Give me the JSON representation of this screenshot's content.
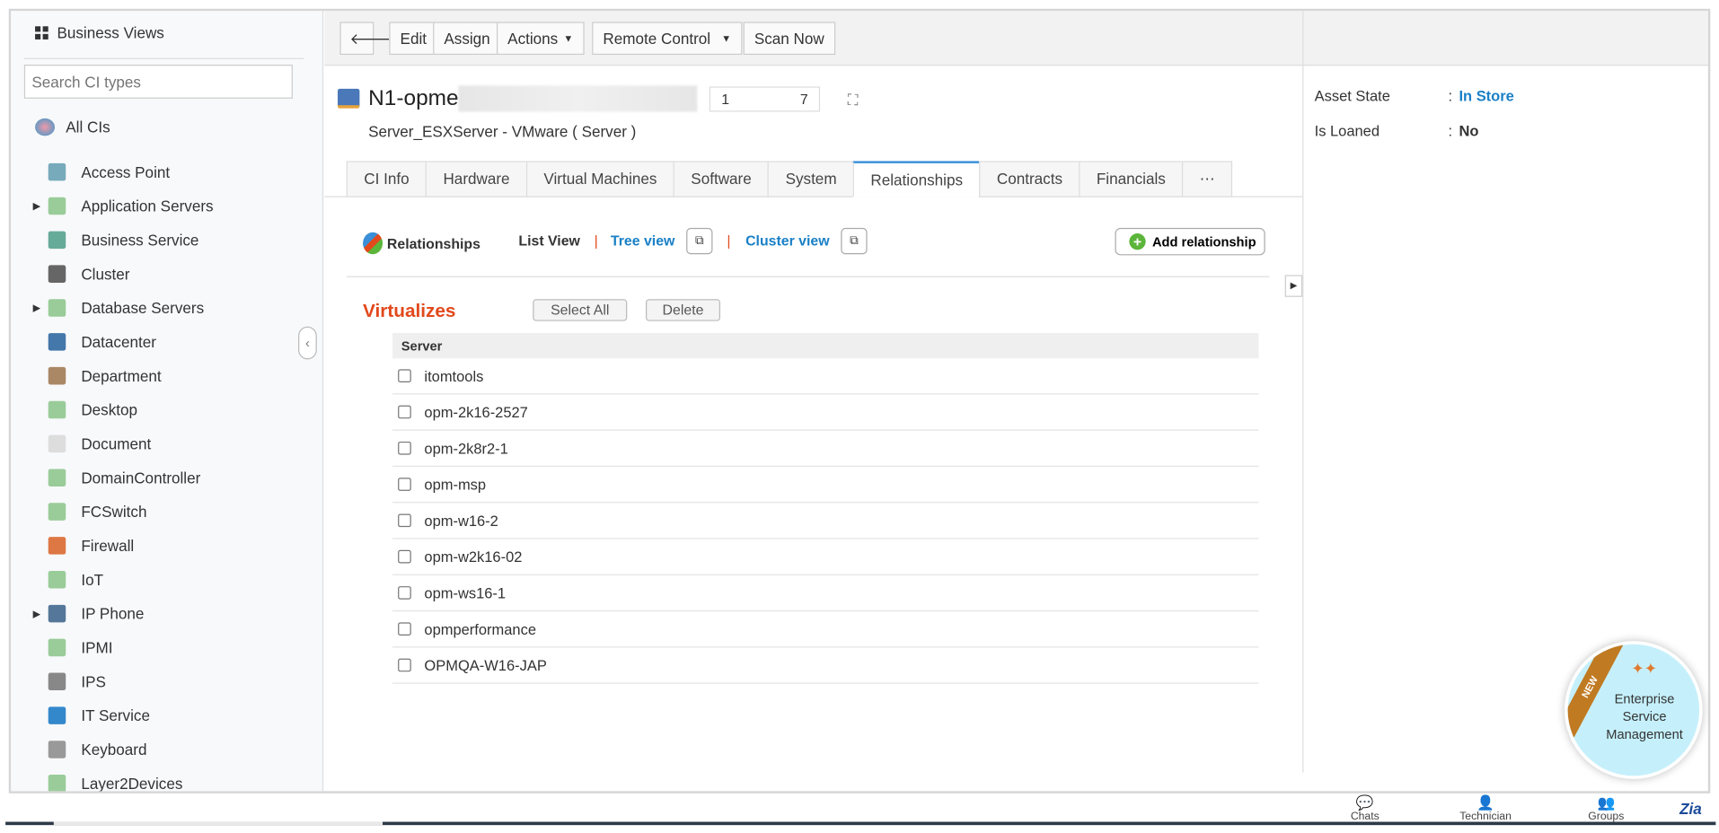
{
  "sidebar": {
    "title": "Business Views",
    "search_placeholder": "Search CI types",
    "all_cis": "All CIs",
    "items": [
      {
        "label": "Access Point",
        "expandable": false,
        "color": "#7ab"
      },
      {
        "label": "Application Servers",
        "expandable": true,
        "color": "#9c9"
      },
      {
        "label": "Business Service",
        "expandable": false,
        "color": "#6a9"
      },
      {
        "label": "Cluster",
        "expandable": false,
        "color": "#666"
      },
      {
        "label": "Database Servers",
        "expandable": true,
        "color": "#9c9"
      },
      {
        "label": "Datacenter",
        "expandable": false,
        "color": "#47a"
      },
      {
        "label": "Department",
        "expandable": false,
        "color": "#a86"
      },
      {
        "label": "Desktop",
        "expandable": false,
        "color": "#9c9"
      },
      {
        "label": "Document",
        "expandable": false,
        "color": "#ddd"
      },
      {
        "label": "DomainController",
        "expandable": false,
        "color": "#9c9"
      },
      {
        "label": "FCSwitch",
        "expandable": false,
        "color": "#9c9"
      },
      {
        "label": "Firewall",
        "expandable": false,
        "color": "#d74"
      },
      {
        "label": "IoT",
        "expandable": false,
        "color": "#9c9"
      },
      {
        "label": "IP Phone",
        "expandable": true,
        "color": "#579"
      },
      {
        "label": "IPMI",
        "expandable": false,
        "color": "#9c9"
      },
      {
        "label": "IPS",
        "expandable": false,
        "color": "#888"
      },
      {
        "label": "IT Service",
        "expandable": false,
        "color": "#38c"
      },
      {
        "label": "Keyboard",
        "expandable": false,
        "color": "#999"
      },
      {
        "label": "Layer2Devices",
        "expandable": false,
        "color": "#9c9"
      }
    ]
  },
  "toolbar": {
    "edit": "Edit",
    "assign": "Assign",
    "actions": "Actions",
    "remote_control": "Remote Control",
    "scan_now": "Scan Now"
  },
  "ci": {
    "name": "N1-opme",
    "id_start": "1",
    "id_end": "7",
    "subtitle": "Server_ESXServer - VMware ( Server )"
  },
  "tabs": [
    "CI Info",
    "Hardware",
    "Virtual Machines",
    "Software",
    "System",
    "Relationships",
    "Contracts",
    "Financials",
    "⋯"
  ],
  "relationships": {
    "title": "Relationships",
    "list_view": "List View",
    "tree_view": "Tree view",
    "cluster_view": "Cluster view",
    "add": "Add relationship",
    "sep": "|"
  },
  "virtualizes": {
    "title": "Virtualizes",
    "select_all": "Select All",
    "delete": "Delete",
    "column": "Server",
    "rows": [
      "itomtools",
      "opm-2k16-2527",
      "opm-2k8r2-1",
      "opm-msp",
      "opm-w16-2",
      "opm-w2k16-02",
      "opm-ws16-1",
      "opmperformance",
      "OPMQA-W16-JAP"
    ]
  },
  "details": {
    "asset_state_label": "Asset State",
    "asset_state": "In Store",
    "loaned_label": "Is Loaned",
    "loaned": "No",
    "colon": ":"
  },
  "esm": {
    "ribbon": "NEW",
    "line1": "Enterprise",
    "line2": "Service",
    "line3": "Management"
  },
  "footer": {
    "chats": "Chats",
    "technician": "Technician",
    "groups": "Groups",
    "zia": "Zia"
  }
}
